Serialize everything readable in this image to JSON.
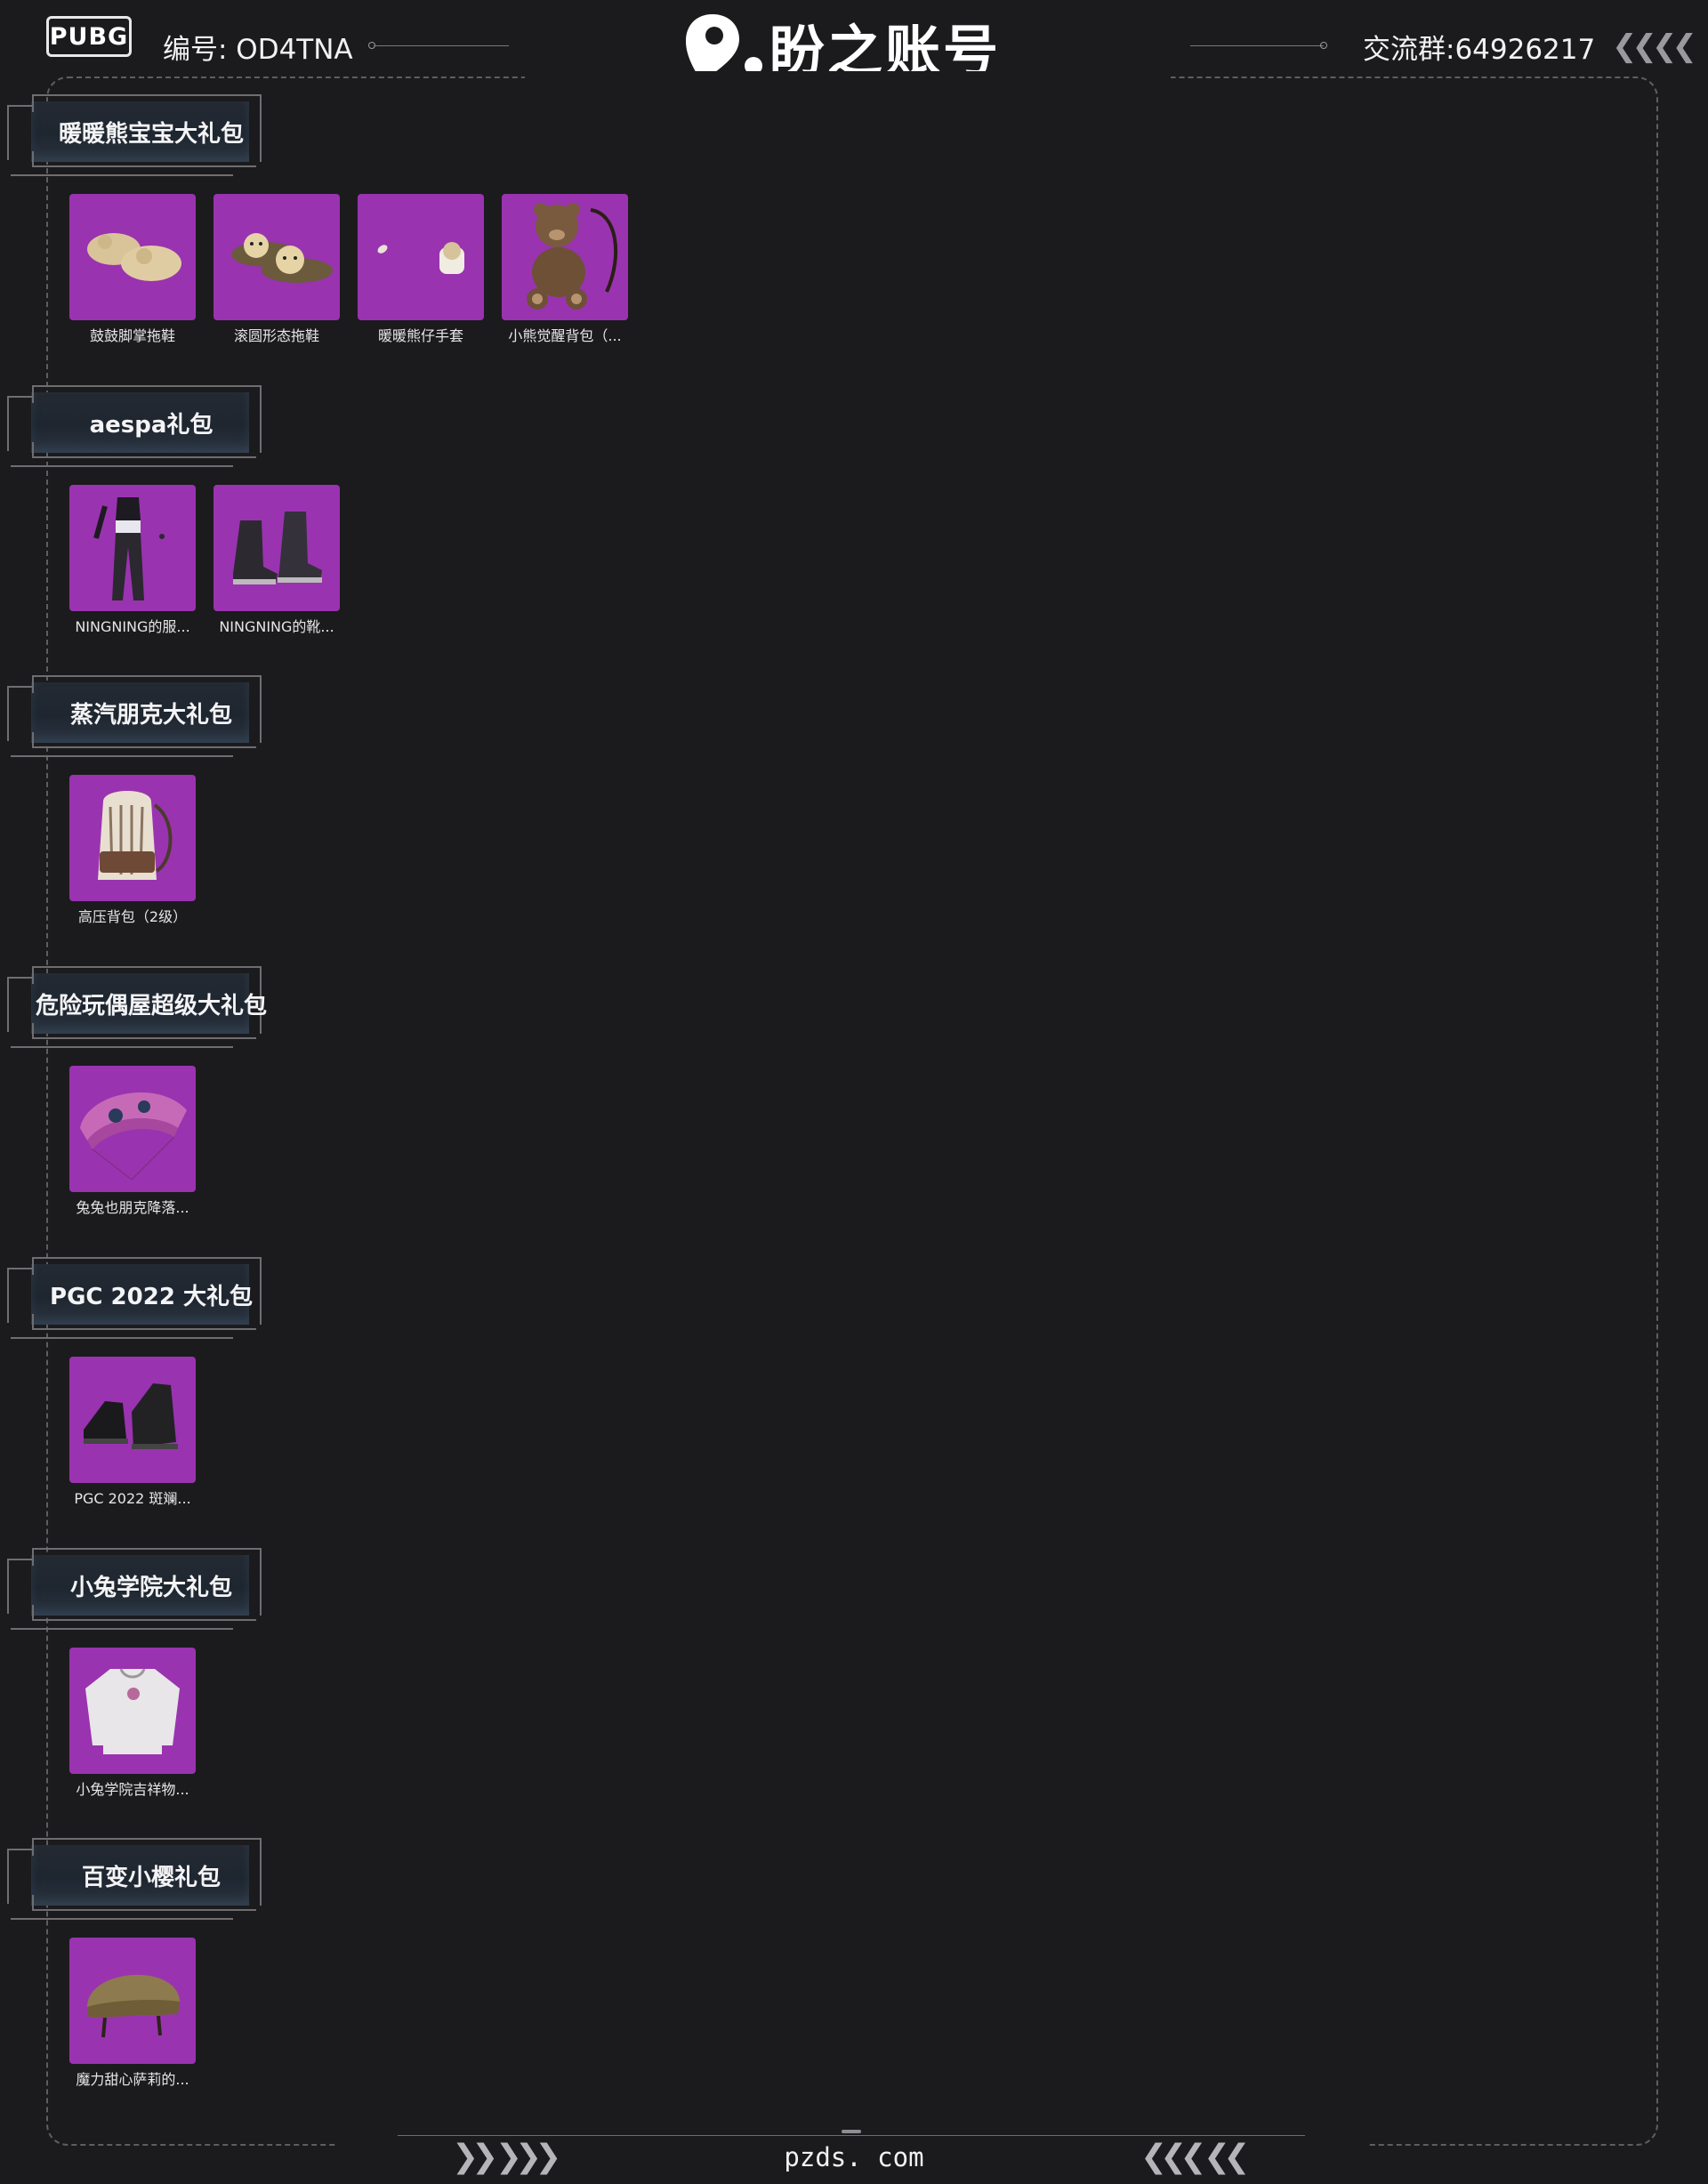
{
  "header": {
    "logo_text": "PUBG",
    "serial": "编号: OD4TNA",
    "brand": "盼之账号",
    "group": "交流群:64926217",
    "chevrons": "❮❮❮❮"
  },
  "sections": [
    {
      "title": "暖暖熊宝宝大礼包",
      "items": [
        {
          "name": "鼓鼓脚掌拖鞋",
          "icon": "fluffy-slippers-icon"
        },
        {
          "name": "滚圆形态拖鞋",
          "icon": "bear-slippers-icon"
        },
        {
          "name": "暖暖熊仔手套",
          "icon": "bear-gloves-icon"
        },
        {
          "name": "小熊觉醒背包（...",
          "icon": "teddy-backpack-icon"
        }
      ]
    },
    {
      "title": "aespa礼包",
      "items": [
        {
          "name": "NINGNING的服...",
          "icon": "outfit-icon"
        },
        {
          "name": "NINGNING的靴...",
          "icon": "boots-icon"
        }
      ]
    },
    {
      "title": "蒸汽朋克大礼包",
      "items": [
        {
          "name": "高压背包（2级）",
          "icon": "backpack-icon"
        }
      ]
    },
    {
      "title": "危险玩偶屋超级大礼包",
      "items": [
        {
          "name": "兔兔也朋克降落...",
          "icon": "parachute-icon"
        }
      ]
    },
    {
      "title": "PGC 2022 大礼包",
      "items": [
        {
          "name": "PGC 2022 斑斓...",
          "icon": "shoes-icon"
        }
      ]
    },
    {
      "title": "小兔学院大礼包",
      "items": [
        {
          "name": "小兔学院吉祥物...",
          "icon": "sweater-icon"
        }
      ]
    },
    {
      "title": "百变小樱礼包",
      "items": [
        {
          "name": "魔力甜心萨莉的...",
          "icon": "helmet-icon"
        }
      ]
    }
  ],
  "footer": {
    "url": "pzds. com",
    "left_arrows": "❯❯ ❯❯❯",
    "right_arrows": "❮❮❮ ❮❮"
  },
  "colors": {
    "background": "#1b1b1d",
    "tile": "#9a33b0",
    "text": "#e8e8ea"
  }
}
